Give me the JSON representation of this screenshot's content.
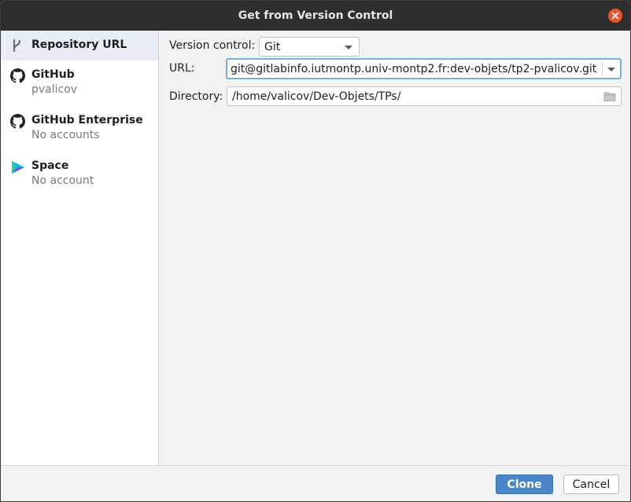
{
  "window": {
    "title": "Get from Version Control"
  },
  "sidebar": {
    "items": [
      {
        "title": "Repository URL",
        "subtitle": ""
      },
      {
        "title": "GitHub",
        "subtitle": "pvalicov"
      },
      {
        "title": "GitHub Enterprise",
        "subtitle": "No accounts"
      },
      {
        "title": "Space",
        "subtitle": "No account"
      }
    ]
  },
  "form": {
    "version_control_label": "Version control:",
    "version_control_value": "Git",
    "url_label": "URL:",
    "url_value": "git@gitlabinfo.iutmontp.univ-montp2.fr:dev-objets/tp2-pvalicov.git",
    "directory_label": "Directory:",
    "directory_value": "/home/valicov/Dev-Objets/TPs/"
  },
  "footer": {
    "clone_label": "Clone",
    "cancel_label": "Cancel"
  },
  "icons": [
    "vcs-branch-icon",
    "github-icon",
    "space-icon",
    "folder-icon",
    "close-icon",
    "dropdown-arrow-icon"
  ],
  "colors": {
    "accent": "#4a86c7",
    "close": "#e9552a",
    "focus_border": "#7aaee0",
    "selection": "#e9eef6"
  }
}
